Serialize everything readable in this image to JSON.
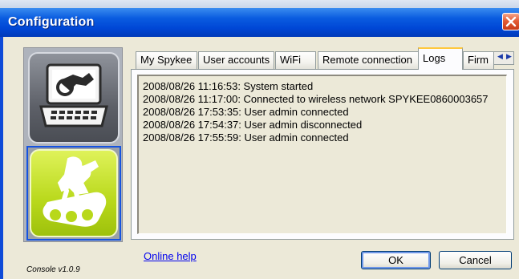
{
  "window": {
    "title": "Configuration"
  },
  "tabs": [
    {
      "label": "My Spykee"
    },
    {
      "label": "User accounts"
    },
    {
      "label": "WiFi"
    },
    {
      "label": "Remote connection"
    },
    {
      "label": "Logs"
    },
    {
      "label": "Firm"
    }
  ],
  "active_tab": "Logs",
  "logs": [
    "2008/08/26 11:16:53: System started",
    "2008/08/26 11:17:00: Connected to wireless network SPYKEE0860003657",
    "2008/08/26 17:53:35: User admin connected",
    "2008/08/26 17:54:37: User admin disconnected",
    "2008/08/26 17:55:59: User admin connected"
  ],
  "footer": {
    "online_help": "Online help",
    "ok_label": "OK",
    "cancel_label": "Cancel",
    "version": "Console v1.0.9"
  },
  "icons": {
    "console": "laptop-robot-icon",
    "logs": "robot-icon",
    "close": "close-icon",
    "tab_scroll_left": "chevron-left-icon",
    "tab_scroll_right": "chevron-right-icon"
  },
  "colors": {
    "titlebar": "#0047d6",
    "logs_tile": "#b8d81a",
    "console_tile": "#5d6068",
    "active_tab_accent": "#ffc83c",
    "link": "#0000ee"
  }
}
